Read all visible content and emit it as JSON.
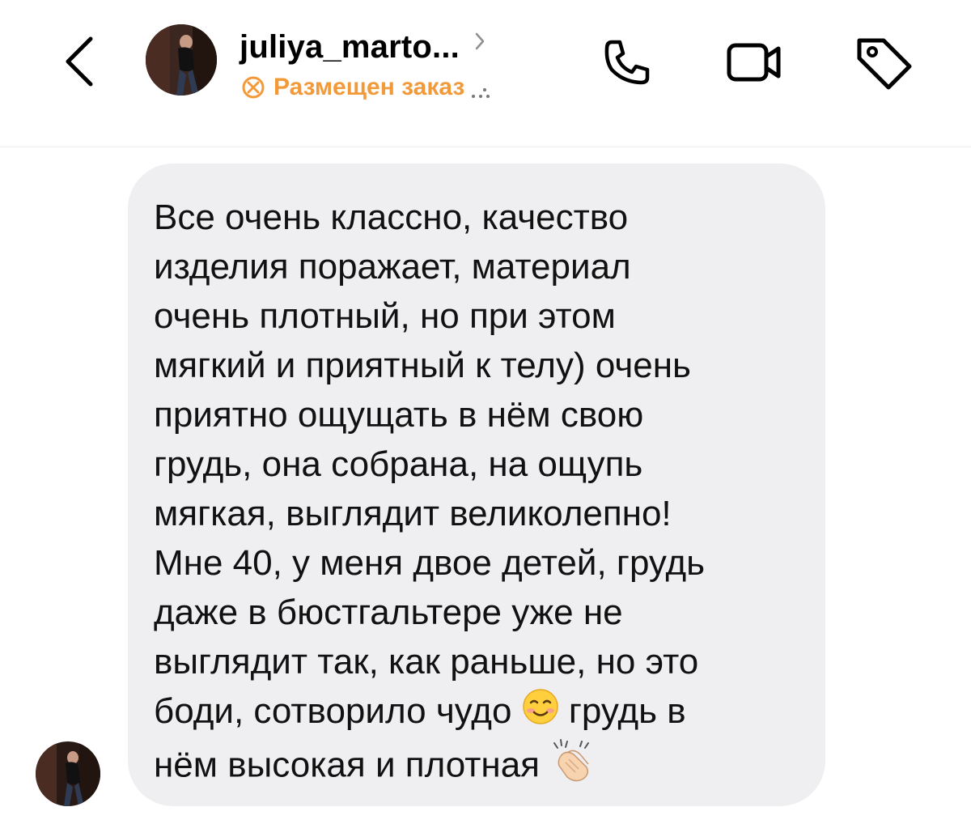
{
  "header": {
    "username": "juliya_marto...",
    "status": "Размещен заказ",
    "status_color": "#f29a3a",
    "back_icon": "chevron-left-icon",
    "call_icon": "phone-icon",
    "video_icon": "video-camera-icon",
    "tag_icon": "tag-icon"
  },
  "message": {
    "lines": [
      "Все очень классно, качество",
      "изделия поражает, материал",
      "очень плотный, но при этом",
      "мягкий и приятный к телу) очень",
      "приятно ощущать в нём свою",
      "грудь, она собрана, на ощупь",
      "мягкая, выглядит великолепно!",
      "Мне 40, у меня двое детей, грудь",
      "даже в бюстгальтере уже не",
      "выглядит так, как раньше, но это"
    ],
    "line11_a": "боди, сотворило чудо ",
    "line11_b": " грудь в",
    "line12": "нём высокая и плотная ",
    "emoji_1": "smiling-face-icon",
    "emoji_2": "clapping-hands-icon",
    "bubble_color": "#efeff1"
  }
}
